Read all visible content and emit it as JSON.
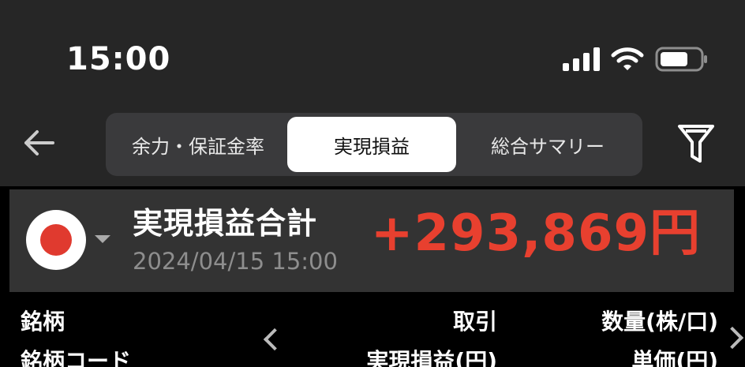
{
  "status_bar": {
    "time": "15:00"
  },
  "nav": {
    "tabs": [
      {
        "label": "余力・保証金率",
        "selected": false
      },
      {
        "label": "実現損益",
        "selected": true
      },
      {
        "label": "総合サマリー",
        "selected": false
      }
    ],
    "icons": {
      "back": "arrow-left-icon",
      "filter": "funnel-filter-icon"
    }
  },
  "summary": {
    "title": "実現損益合計",
    "datetime": "2024/04/15 15:00",
    "amount": "+293,869円",
    "amount_color": "#e8402f",
    "market_flag": "japan-flag-icon"
  },
  "table_header": {
    "row1": {
      "col1": "銘柄",
      "col2": "取引",
      "col3": "数量(株/口)"
    },
    "row2": {
      "col1": "銘柄コード",
      "col2": "実現損益(円)",
      "col3": "単価(円)"
    }
  },
  "colors": {
    "background": "#000000",
    "header_bg": "#262626",
    "card_bg": "#333333",
    "accent_negative": "#e8402f"
  }
}
